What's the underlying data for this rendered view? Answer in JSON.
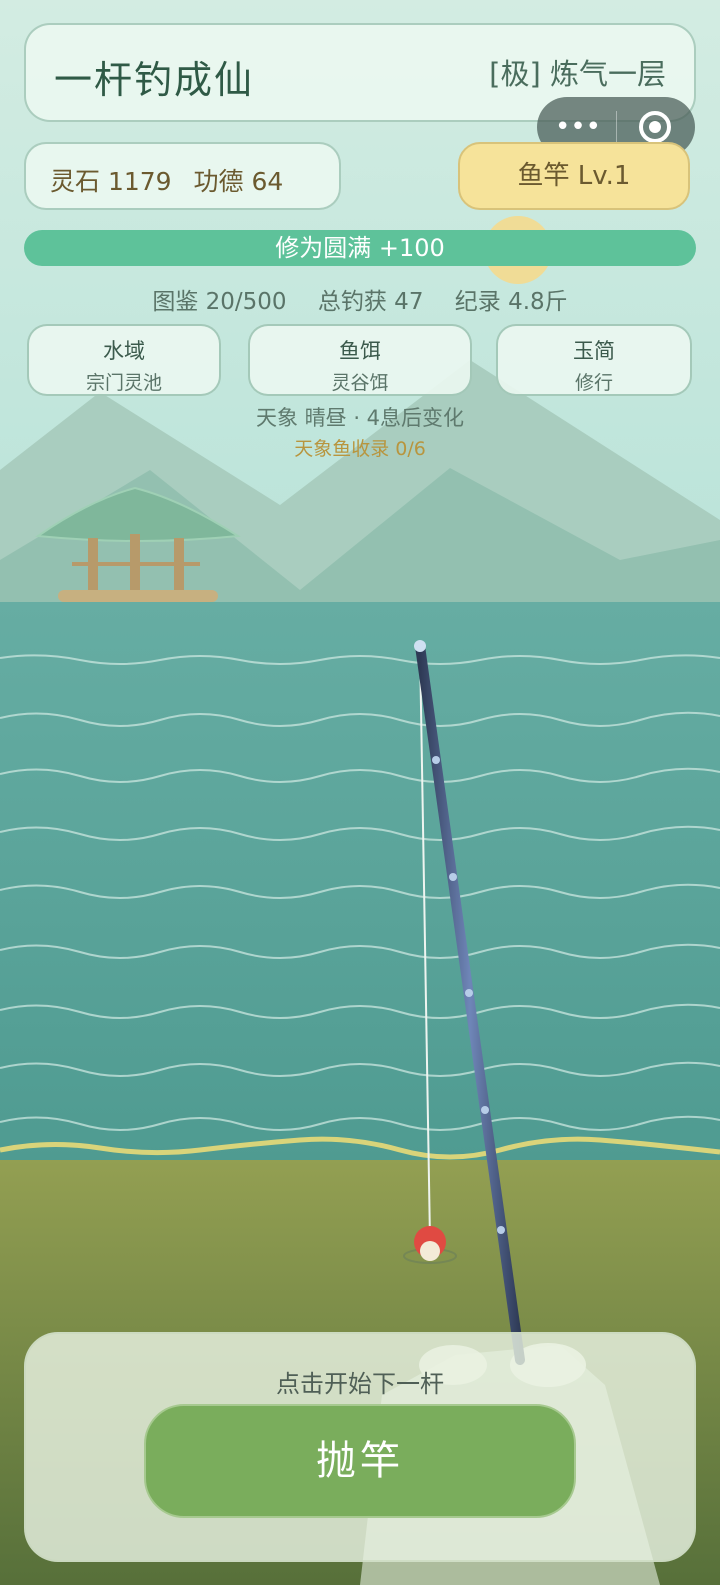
{
  "header": {
    "title": "一杆钓成仙",
    "realm": "[极] 炼气一层"
  },
  "capsule": {
    "more_icon": "more-dots-icon",
    "close_icon": "target-circle-icon",
    "more_glyph": "•••"
  },
  "resources": {
    "spirit_stone": "灵石 1179",
    "merit": "功德 64"
  },
  "rod_button": "鱼竿 Lv.1",
  "cultivation_bar": {
    "label": "修为圆满 +100",
    "fill": 1.0
  },
  "stats": {
    "codex": "图鉴 20/500",
    "total": "总钓获 47",
    "record": "纪录 4.8斤"
  },
  "selectors": {
    "water": {
      "title": "水域",
      "value": "宗门灵池"
    },
    "bait": {
      "title": "鱼饵",
      "value": "灵谷饵"
    },
    "scroll": {
      "title": "玉简",
      "value": "修行"
    }
  },
  "weather": {
    "line": "天象 晴昼 · 4息后变化",
    "fish_log": "天象鱼收录 0/6"
  },
  "action": {
    "hint": "点击开始下一杆",
    "cast_label": "抛竿"
  },
  "colors": {
    "sky_top": "#cfe9e0",
    "water": "#5aa69c",
    "bank": "#8b9a4c",
    "progress": "#5ec29a",
    "rod_button": "#f6e39a",
    "cast_button": "#7aad5c",
    "bobber": "#e04a42"
  }
}
